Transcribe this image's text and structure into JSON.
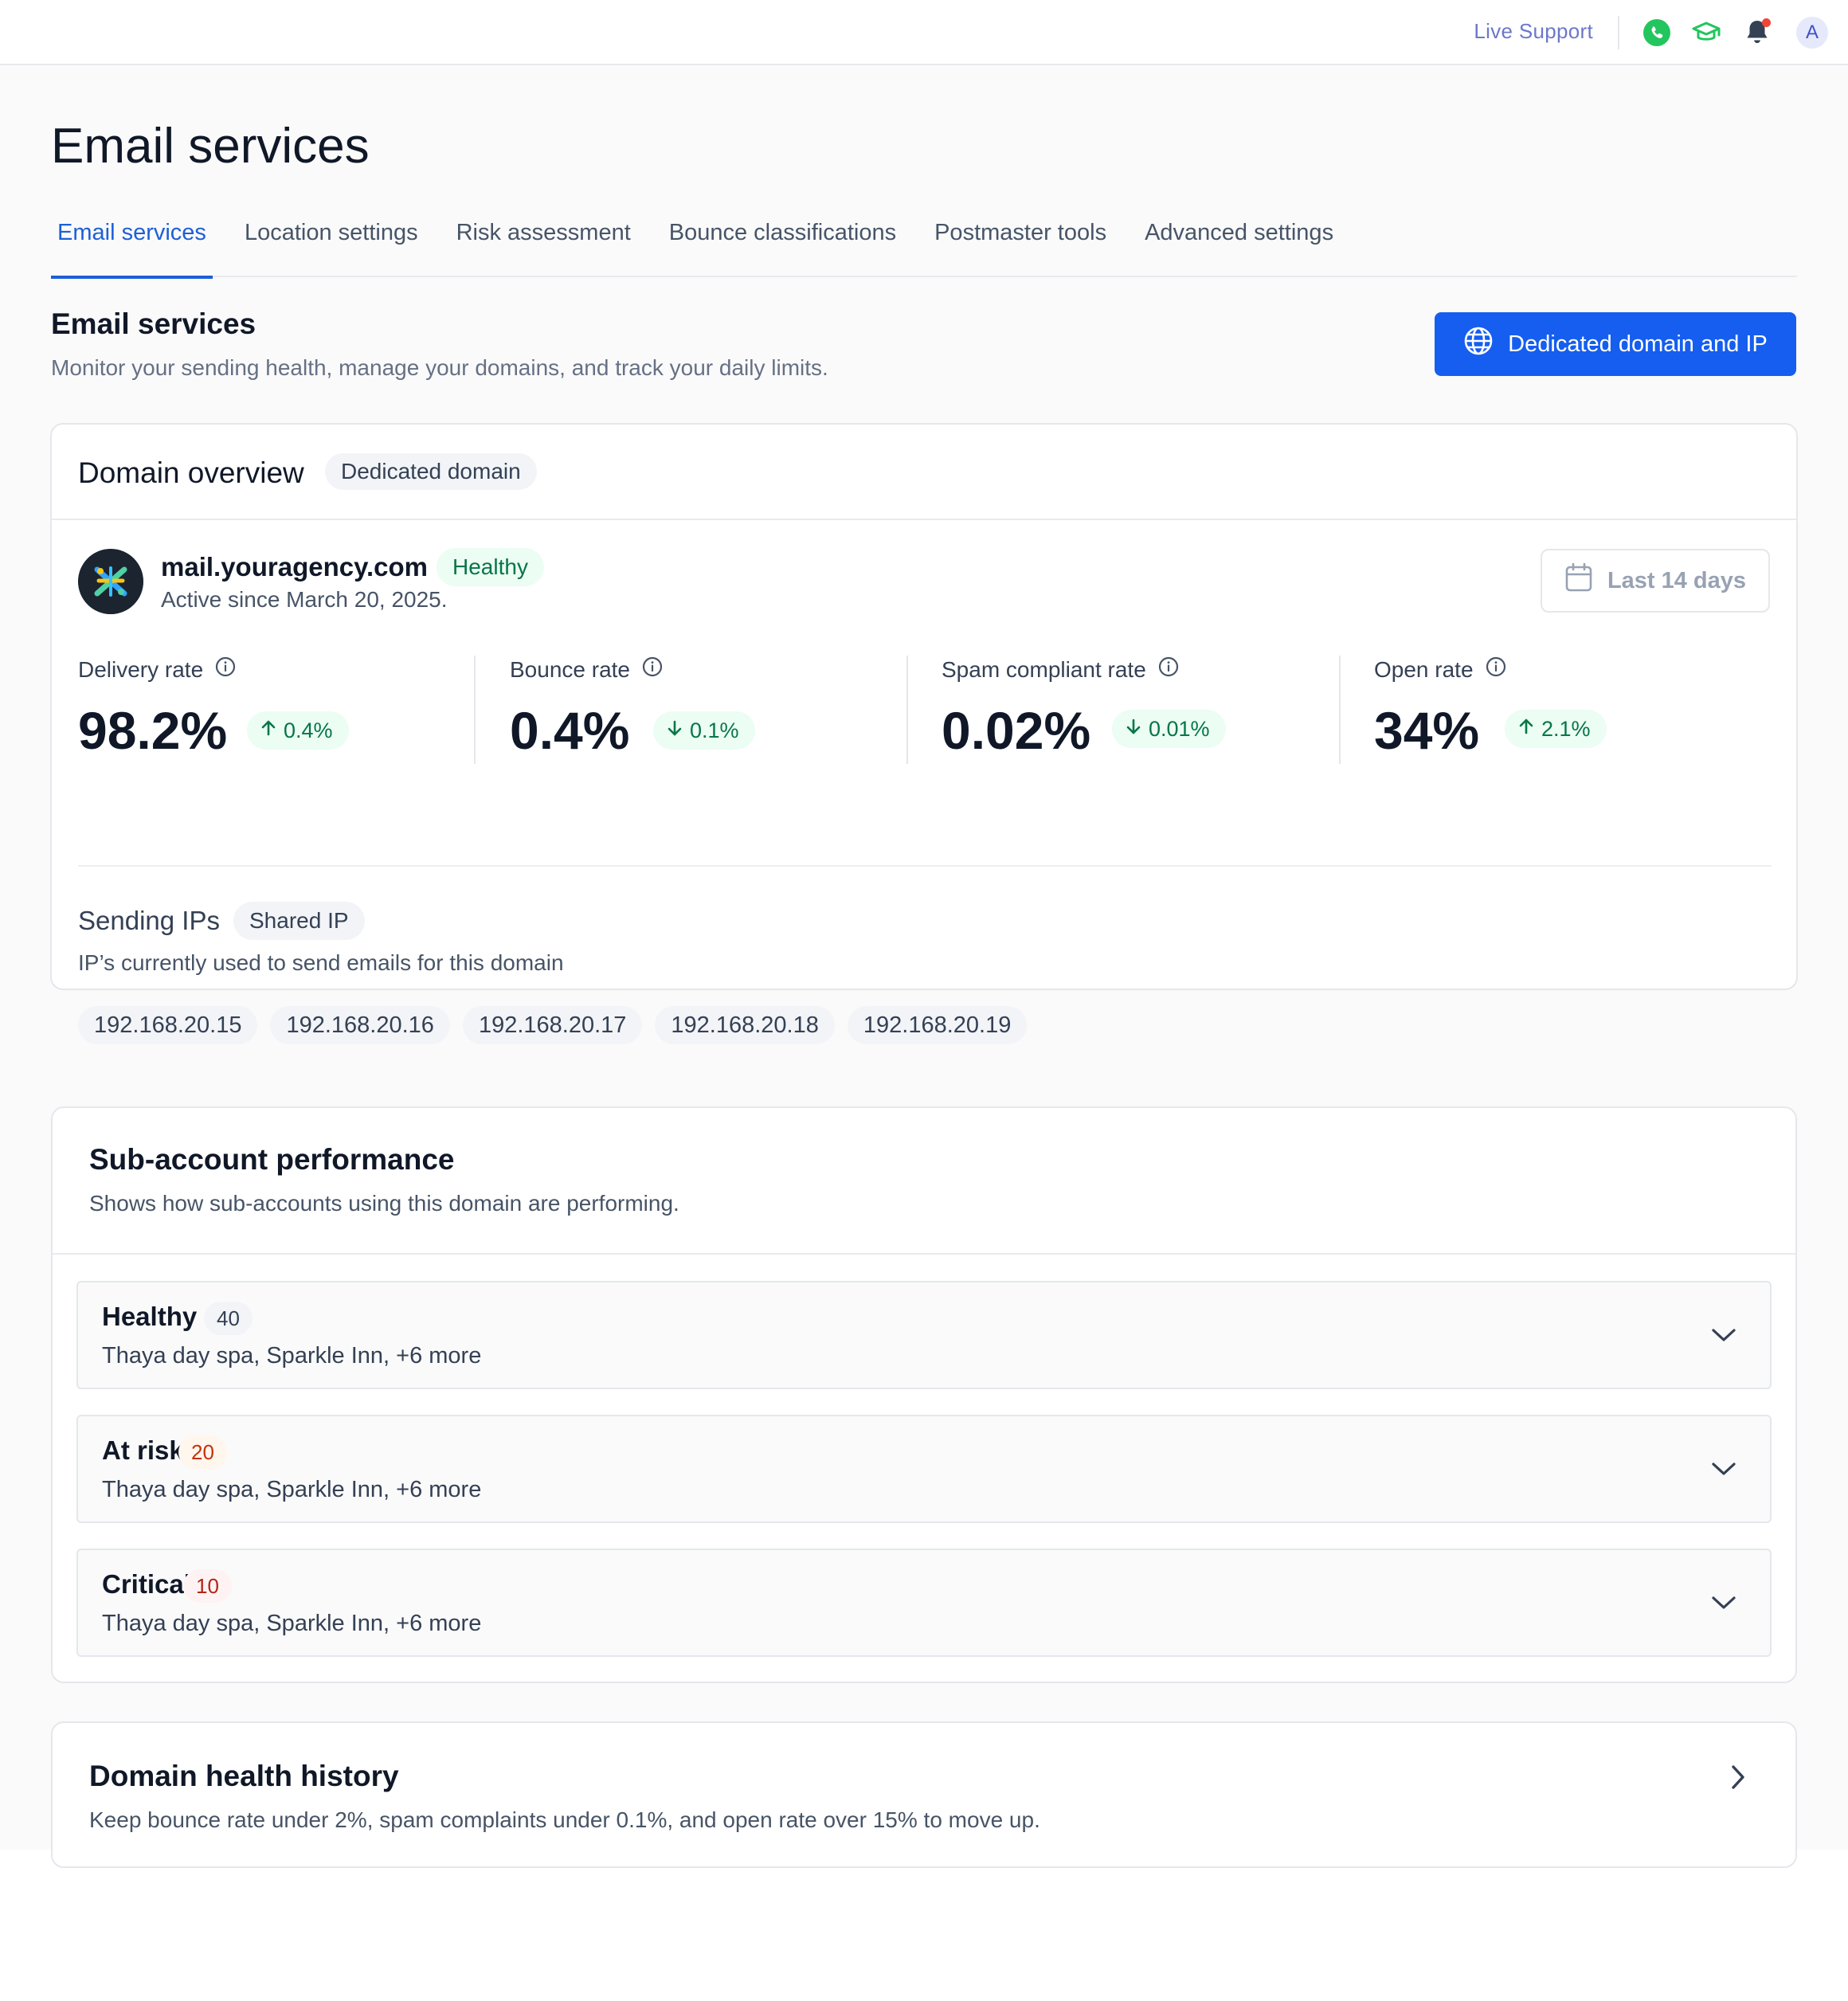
{
  "topbar": {
    "live_support": "Live Support",
    "avatar_initial": "A"
  },
  "page": {
    "title": "Email services"
  },
  "tabs": [
    {
      "label": "Email services",
      "active": true
    },
    {
      "label": "Location settings",
      "active": false
    },
    {
      "label": "Risk assessment",
      "active": false
    },
    {
      "label": "Bounce classifications",
      "active": false
    },
    {
      "label": "Postmaster tools",
      "active": false
    },
    {
      "label": "Advanced settings",
      "active": false
    }
  ],
  "section": {
    "title": "Email services",
    "subtitle": "Monitor your sending health, manage your domains, and track your daily limits.",
    "primary_button": "Dedicated domain and IP"
  },
  "overview": {
    "title": "Domain overview",
    "badge": "Dedicated domain",
    "domain": "mail.youragency.com",
    "status": "Healthy",
    "active_since": "Active since March 20, 2025.",
    "date_range": "Last 14 days",
    "metrics": [
      {
        "label": "Delivery rate",
        "value": "98.2%",
        "delta": "0.4%",
        "direction": "up"
      },
      {
        "label": "Bounce rate",
        "value": "0.4%",
        "delta": "0.1%",
        "direction": "down"
      },
      {
        "label": "Spam compliant rate",
        "value": "0.02%",
        "delta": "0.01%",
        "direction": "down"
      },
      {
        "label": "Open rate",
        "value": "34%",
        "delta": "2.1%",
        "direction": "up"
      }
    ],
    "sending_ips": {
      "title": "Sending IPs",
      "badge": "Shared IP",
      "subtitle": "IP’s currently used to send emails for this domain",
      "ips": [
        "192.168.20.15",
        "192.168.20.16",
        "192.168.20.17",
        "192.168.20.18",
        "192.168.20.19"
      ]
    }
  },
  "subaccounts": {
    "title": "Sub-account performance",
    "subtitle": "Shows how sub-accounts using this domain are performing.",
    "groups": [
      {
        "label": "Healthy",
        "count": "40",
        "accounts": "Thaya day spa, Sparkle Inn, +6 more"
      },
      {
        "label": "At risk",
        "count": "20",
        "accounts": "Thaya day spa, Sparkle Inn, +6 more"
      },
      {
        "label": "Critical",
        "count": "10",
        "accounts": "Thaya day spa, Sparkle Inn, +6 more"
      }
    ]
  },
  "history": {
    "title": "Domain health history",
    "subtitle": "Keep bounce rate under 2%, spam complaints under 0.1%, and open rate over 15% to move up."
  },
  "colors": {
    "accent": "#155eef",
    "tab_active": "#1d5fd6",
    "healthy_bg": "#ecfdf3",
    "healthy_text": "#067647",
    "at_risk_bg": "#fff6ed",
    "at_risk_text": "#c4320a",
    "critical_bg": "#fef3f2",
    "critical_text": "#b42318"
  },
  "icons": {
    "phone": "phone-icon",
    "academy": "graduation-cap-icon",
    "notifications": "bell-icon",
    "globe": "globe-icon",
    "calendar": "calendar-icon",
    "info": "info-icon",
    "expand": "chevron-down-icon",
    "navigate": "chevron-right-icon"
  }
}
